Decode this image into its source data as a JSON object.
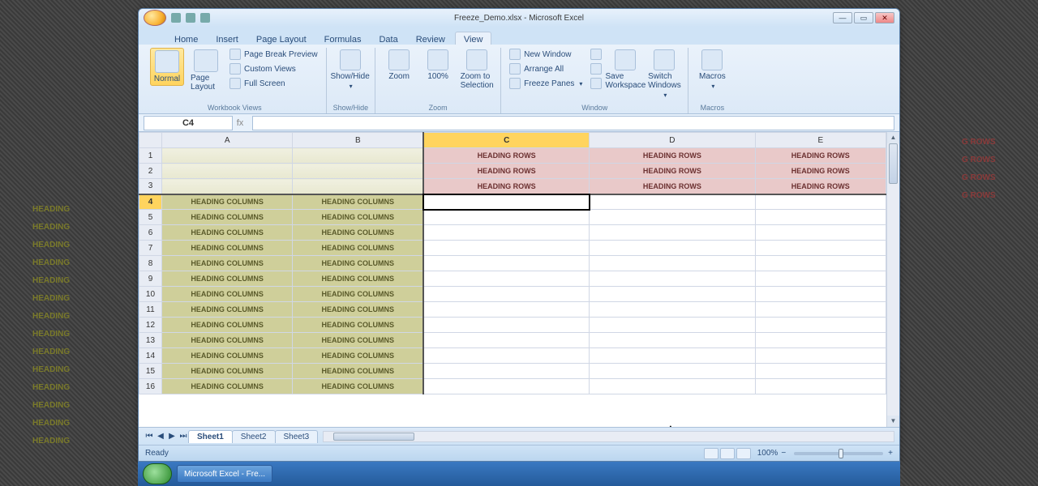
{
  "window": {
    "title": "Freeze_Demo.xlsx - Microsoft Excel",
    "min": "—",
    "max": "▭",
    "close": "✕"
  },
  "tabs": [
    "Home",
    "Insert",
    "Page Layout",
    "Formulas",
    "Data",
    "Review",
    "View"
  ],
  "active_tab": "View",
  "ribbon": {
    "views": {
      "normal": "Normal",
      "page_layout": "Page Layout",
      "page_break": "Page Break Preview",
      "custom": "Custom Views",
      "full": "Full Screen",
      "group": "Workbook Views"
    },
    "showhide": {
      "label": "Show/Hide",
      "group": "Show/Hide"
    },
    "zoom": {
      "zoom": "Zoom",
      "hundred": "100%",
      "to_sel": "Zoom to Selection",
      "group": "Zoom"
    },
    "window_grp": {
      "new_win": "New Window",
      "arrange": "Arrange All",
      "freeze": "Freeze Panes",
      "save_ws": "Save Workspace",
      "switch": "Switch Windows",
      "group": "Window"
    },
    "macros": {
      "label": "Macros",
      "group": "Macros"
    }
  },
  "namebox": "C4",
  "columns": [
    "A",
    "B",
    "C",
    "D",
    "E"
  ],
  "col_widths": [
    "150px",
    "150px",
    "190px",
    "190px",
    "150px"
  ],
  "selected_col": "C",
  "selected_row": 4,
  "row_count": 16,
  "heading_row_text": "HEADING ROWS",
  "heading_col_text": "HEADING COLUMNS",
  "sheets": [
    "Sheet1",
    "Sheet2",
    "Sheet3"
  ],
  "active_sheet": "Sheet1",
  "status": {
    "ready": "Ready",
    "zoom": "100%"
  },
  "taskbar": {
    "app": "Microsoft Excel - Fre...",
    "time": ""
  },
  "overlay_rows": 18
}
